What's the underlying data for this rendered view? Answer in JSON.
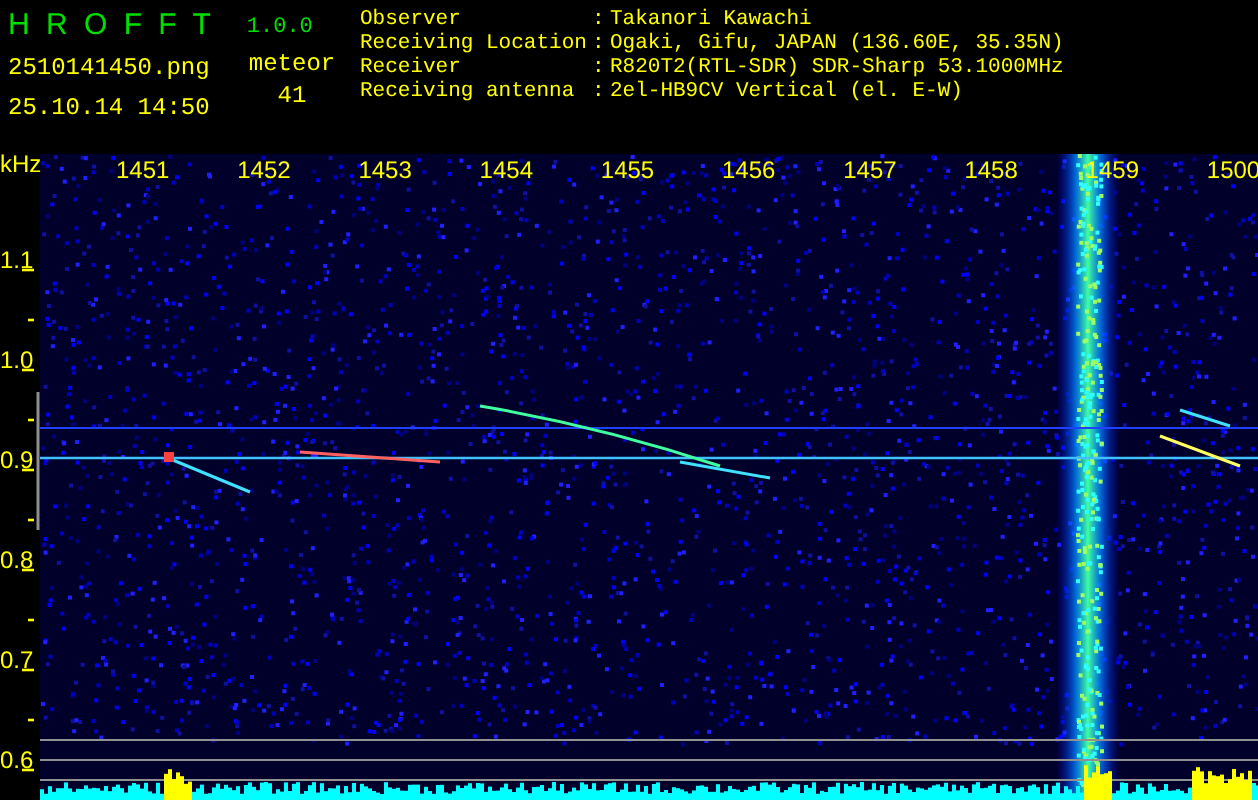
{
  "app": {
    "title": "H R O F F T",
    "version": "1.0.0"
  },
  "file": "2510141450.png",
  "datetime": "25.10.14 14:50",
  "counter": {
    "label": "meteor",
    "value": "41"
  },
  "station": [
    {
      "label": "Observer",
      "separator": ":",
      "value": "Takanori Kawachi"
    },
    {
      "label": "Receiving Location",
      "separator": ":",
      "value": "Ogaki, Gifu, JAPAN (136.60E, 35.35N)"
    },
    {
      "label": "Receiver",
      "separator": ":",
      "value": "R820T2(RTL-SDR) SDR-Sharp 53.1000MHz"
    },
    {
      "label": "Receiving antenna",
      "separator": ":",
      "value": "2el-HB9CV Vertical (el. E-W)"
    }
  ],
  "plot": {
    "y_unit": "kHz",
    "time_labels": [
      "1451",
      "1452",
      "1453",
      "1454",
      "1455",
      "1456",
      "1457",
      "1458",
      "1459",
      "1500"
    ],
    "freq_labels": [
      "1.1",
      "1.0",
      "0.9",
      "0.8",
      "0.7",
      "0.6"
    ]
  }
}
